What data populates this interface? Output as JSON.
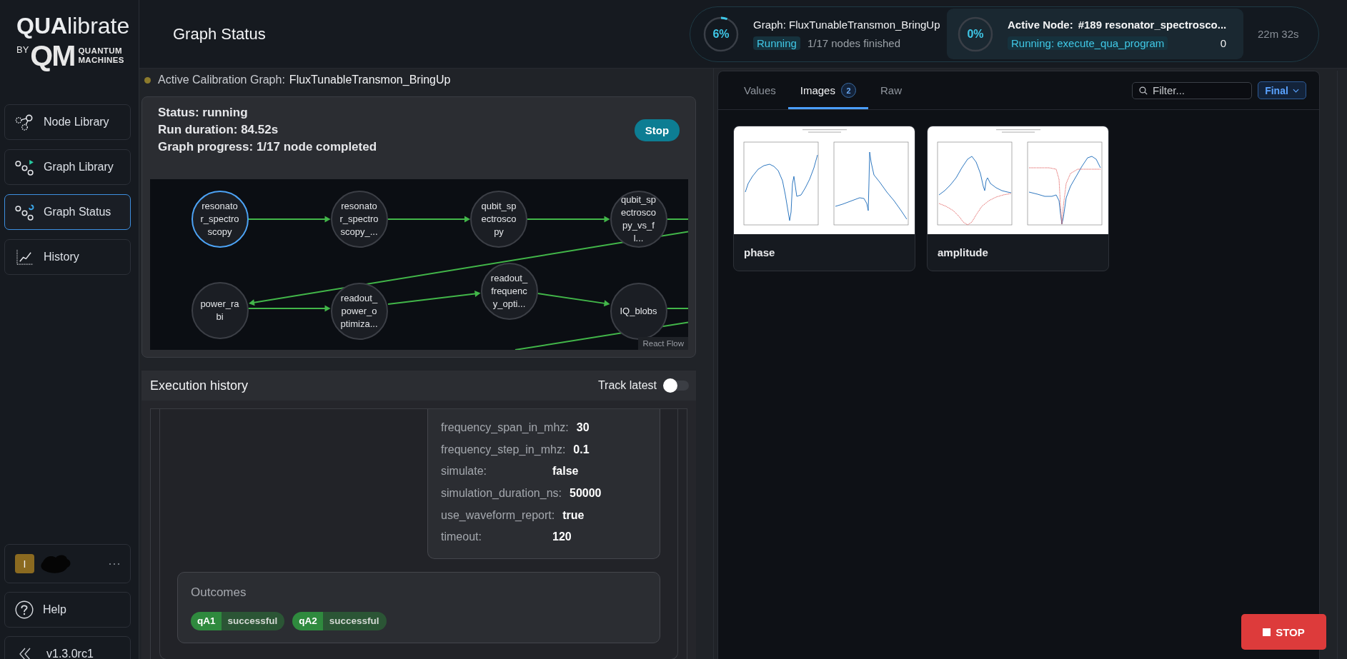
{
  "sidebar": {
    "logo": {
      "wordmark": "**QUA**librate",
      "byline": "BY",
      "mark": "QM",
      "company_line_1": "QUANTUM",
      "company_line_2": "MACHINES"
    },
    "nav": [
      {
        "label": "Node Library",
        "selected": false
      },
      {
        "label": "Graph Library",
        "selected": false
      },
      {
        "label": "Graph Status",
        "selected": true
      },
      {
        "label": "History",
        "selected": false
      }
    ],
    "user": {
      "initial": "I"
    },
    "help": {
      "label": "Help"
    },
    "version": {
      "label": "v1.3.0rc1"
    }
  },
  "header": {
    "title": "Graph Status",
    "graph": {
      "percent": "6%",
      "level": 0.06,
      "name": "Graph: FluxTunableTransmon_BringUp",
      "state": "Running",
      "progress": "1/17 nodes finished"
    },
    "active_node": {
      "percent": "0%",
      "level": 0,
      "label": "Active Node:",
      "name": "#189 resonator_spectrosco...",
      "state": "Running: execute_qua_program",
      "count": "0"
    },
    "elapsed": "22m 32s"
  },
  "active_graph": {
    "label": "Active Calibration Graph:",
    "name": "FluxTunableTransmon_BringUp"
  },
  "status_card": {
    "lines": [
      "Status: running",
      "Run duration: 84.52s",
      "Graph progress: 1/17 node completed"
    ],
    "stop_button": "Stop"
  },
  "graph": {
    "nodes": [
      {
        "label": "resonator_spectroscopy",
        "running": true
      },
      {
        "label": "resonator_spectroscopy_...",
        "running": false
      },
      {
        "label": "qubit_spectroscopy",
        "running": false
      },
      {
        "label": "qubit_spectroscopy_vs_fl...",
        "running": false
      },
      {
        "label": "power_rabi",
        "running": false
      },
      {
        "label": "readout_power_optimiza...",
        "running": false
      },
      {
        "label": "readout_frequency_opti...",
        "running": false
      },
      {
        "label": "IQ_blobs",
        "running": false
      }
    ],
    "attribution": "React Flow"
  },
  "execution_history": {
    "title": "Execution history",
    "track_latest": {
      "label": "Track latest",
      "on": false
    },
    "parameters": [
      {
        "name": "frequency_span_in_mhz:",
        "value": "30"
      },
      {
        "name": "frequency_step_in_mhz:",
        "value": "0.1"
      },
      {
        "name": "simulate:",
        "value": "false"
      },
      {
        "name": "simulation_duration_ns:",
        "value": "50000"
      },
      {
        "name": "use_waveform_report:",
        "value": "true"
      },
      {
        "name": "timeout:",
        "value": "120"
      }
    ],
    "outcomes": {
      "title": "Outcomes",
      "items": [
        {
          "target": "qA1",
          "result": "successful"
        },
        {
          "target": "qA2",
          "result": "successful"
        }
      ]
    }
  },
  "results_panel": {
    "tabs": [
      {
        "label": "Values",
        "selected": false
      },
      {
        "label": "Images",
        "selected": true,
        "badge": "2"
      },
      {
        "label": "Raw",
        "selected": false
      }
    ],
    "filter": {
      "placeholder": "Filter..."
    },
    "stage_button": "Final",
    "images": [
      {
        "title": "phase"
      },
      {
        "title": "amplitude"
      }
    ]
  },
  "stop_all_button": "STOP"
}
